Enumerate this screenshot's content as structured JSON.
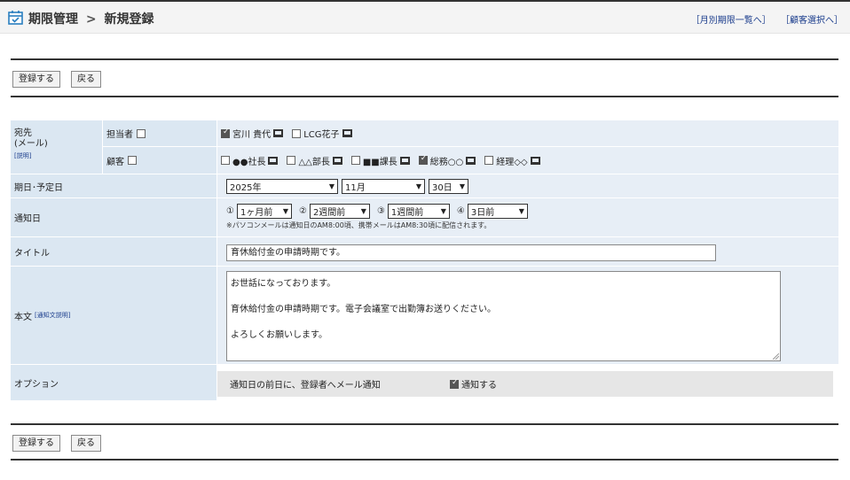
{
  "header": {
    "title_main": "期限管理",
    "title_sep": ">",
    "title_sub": "新規登録",
    "link_monthly": "［月別期限一覧へ］",
    "link_customer": "［顧客選択へ］"
  },
  "toolbar": {
    "register_label": "登録する",
    "back_label": "戻る"
  },
  "form": {
    "dest_label": "宛先\n(メール)",
    "dest_explain": "[説明]",
    "staff_label": "担当者",
    "staff_checked": false,
    "staff_recipients": [
      {
        "name": "宮川 貴代",
        "checked": true
      },
      {
        "name": "LCG花子",
        "checked": false
      }
    ],
    "client_label": "顧客",
    "client_checked": false,
    "client_recipients": [
      {
        "name": "●●社長",
        "checked": false
      },
      {
        "name": "△△部長",
        "checked": false
      },
      {
        "name": "■■課長",
        "checked": false
      },
      {
        "name": "総務○○",
        "checked": true
      },
      {
        "name": "経理◇◇",
        "checked": false
      }
    ],
    "due_label": "期日･予定日",
    "due_year": "2025年",
    "due_month": "11月",
    "due_day": "30日",
    "notify_label": "通知日",
    "notify_options": [
      {
        "mark": "①",
        "value": "1ヶ月前"
      },
      {
        "mark": "②",
        "value": "2週間前"
      },
      {
        "mark": "③",
        "value": "1週間前"
      },
      {
        "mark": "④",
        "value": "3日前"
      }
    ],
    "notify_note": "※パソコンメールは通知日のAM8:00頃、携帯メールはAM8:30頃に配信されます。",
    "title_label": "タイトル",
    "title_value": "育休給付金の申請時期です。",
    "body_label": "本文",
    "body_explain": "[通知文説明]",
    "body_value": "お世話になっております。\n\n育休給付金の申請時期です。電子会議室で出勤簿お送りください。\n\nよろしくお願いします。",
    "option_label": "オプション",
    "option_desc": "通知日の前日に、登録者へメール通知",
    "option_checkbox_label": "通知する",
    "option_checked": true
  },
  "colors": {
    "label_bg": "#dbe7f2",
    "value_bg": "#e7eef6",
    "link": "#1a3c8c",
    "accent": "#2a7fc0"
  }
}
